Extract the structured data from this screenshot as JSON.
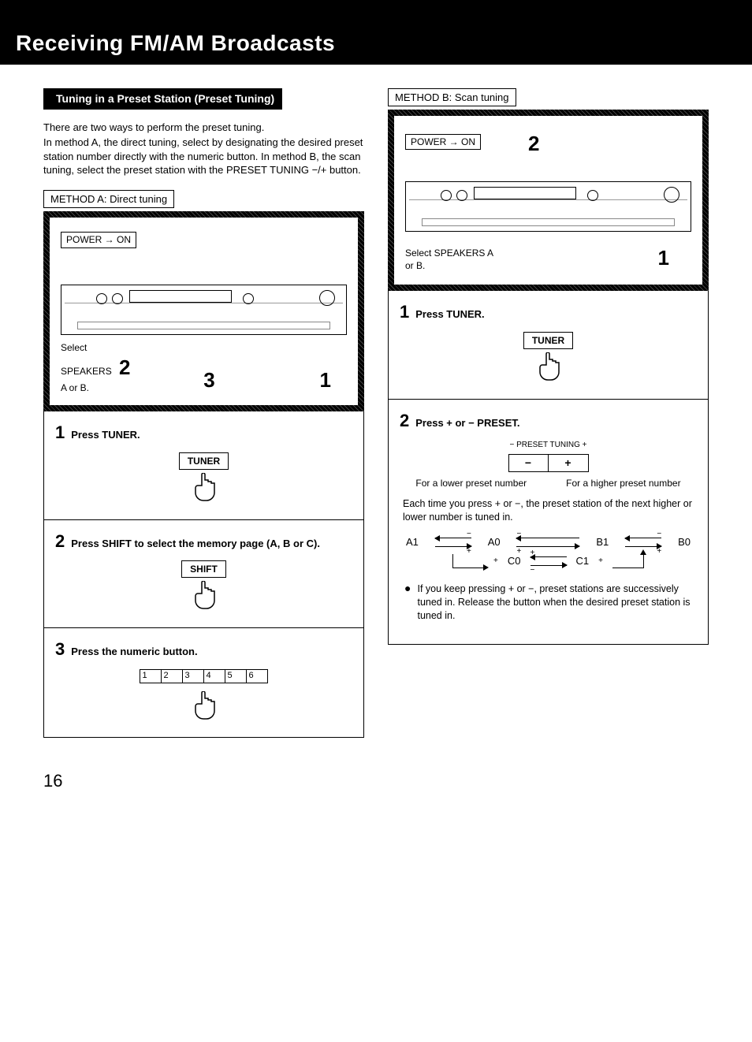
{
  "page_title": "Receiving FM/AM Broadcasts",
  "page_number": "16",
  "section_heading": "Tuning in a Preset Station (Preset Tuning)",
  "intro": {
    "line1": "There are two ways to perform the preset tuning.",
    "line2": "In method A, the direct tuning, select by designating the desired preset station number directly with the numeric button. In method B, the scan tuning, select the preset station with the PRESET TUNING −/+ button."
  },
  "method_a": {
    "label": "METHOD A: Direct tuning",
    "power": "POWER → ON",
    "select_speakers_line1": "Select",
    "select_speakers_line2": "SPEAKERS",
    "select_speakers_line3": "A or B.",
    "callout_2": "2",
    "callout_3": "3",
    "callout_1": "1",
    "step1": {
      "num": "1",
      "text": "Press TUNER.",
      "button": "TUNER"
    },
    "step2": {
      "num": "2",
      "text": "Press SHIFT to select the memory page (A, B or C).",
      "button": "SHIFT"
    },
    "step3": {
      "num": "3",
      "text": "Press the numeric button.",
      "buttons": [
        "1",
        "2",
        "3",
        "4",
        "5",
        "6"
      ]
    }
  },
  "method_b": {
    "label": "METHOD B: Scan tuning",
    "power": "POWER → ON",
    "callout_2": "2",
    "callout_1": "1",
    "select_speakers": "Select SPEAKERS A or B.",
    "step1": {
      "num": "1",
      "text": "Press TUNER.",
      "button": "TUNER"
    },
    "step2": {
      "num": "2",
      "text": "Press + or − PRESET.",
      "caption": "− PRESET TUNING +",
      "minus": "−",
      "plus": "+",
      "lower": "For a lower preset number",
      "higher": "For a higher preset number",
      "body": "Each time you press + or −, the preset station of the next higher or lower number is tuned in.",
      "cycle_labels": {
        "a1": "A1",
        "a0": "A0",
        "b1": "B1",
        "b0": "B0",
        "c0": "C0",
        "c1": "C1"
      },
      "cycle_signs": {
        "minus": "−",
        "plus": "+"
      },
      "note": "If you keep pressing + or −, preset stations are successively tuned in. Release the button when the desired preset station is tuned in."
    }
  }
}
